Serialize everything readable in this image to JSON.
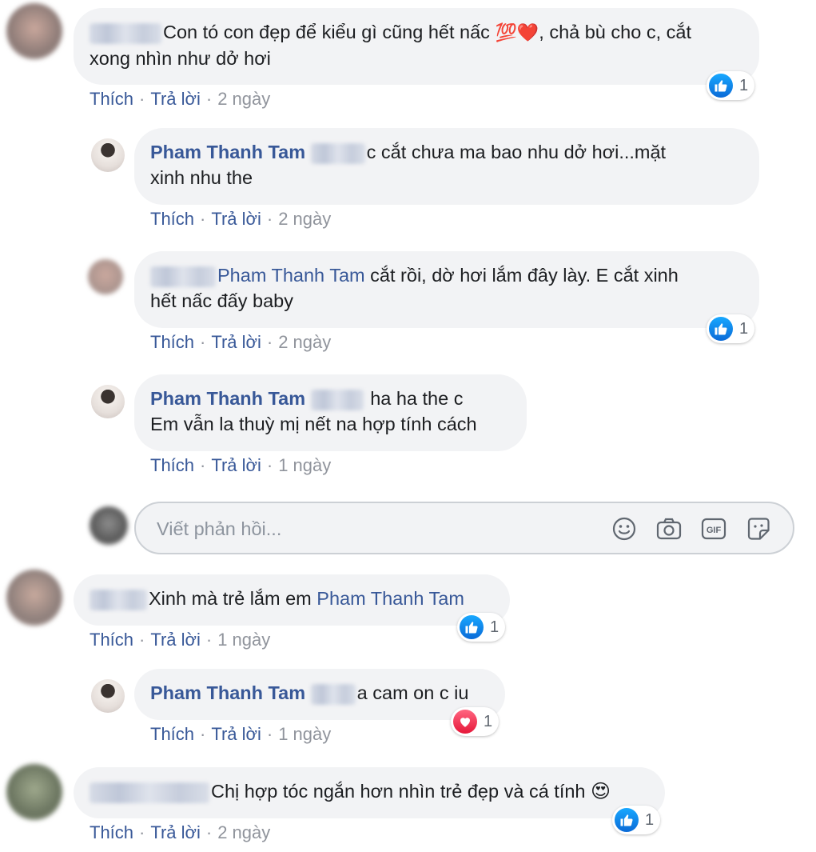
{
  "comments": [
    {
      "text": "Con tó con đẹp để kiểu gì cũng hết nấc",
      "emoji": "💯❤️",
      "text_after": ", chả bù cho c, cắt",
      "text_line2": "xong nhìn như dở hơi",
      "actions": {
        "like": "Thích",
        "reply": "Trả lời",
        "time": "2 ngày"
      },
      "reaction": {
        "type": "like",
        "count": "1"
      }
    },
    {
      "author": "Pham Thanh Tam",
      "text": "c cắt chưa ma bao nhu dở hơi...mặt",
      "text_line2": "xinh nhu the",
      "actions": {
        "like": "Thích",
        "reply": "Trả lời",
        "time": "2 ngày"
      }
    },
    {
      "mention": "Pham Thanh Tam",
      "text": " cắt rồi, dờ hơi lắm đây lày. E cắt xinh",
      "text_line2": "hết nấc đấy baby",
      "actions": {
        "like": "Thích",
        "reply": "Trả lời",
        "time": "2 ngày"
      },
      "reaction": {
        "type": "like",
        "count": "1"
      }
    },
    {
      "author": "Pham Thanh Tam",
      "text": "ha ha the c",
      "text_line2": "Em vẫn la thuỳ mị nết na hợp tính cách",
      "actions": {
        "like": "Thích",
        "reply": "Trả lời",
        "time": "1 ngày"
      }
    },
    {
      "text": "Xinh mà trẻ lắm em ",
      "mention": "Pham Thanh Tam",
      "actions": {
        "like": "Thích",
        "reply": "Trả lời",
        "time": "1 ngày"
      },
      "reaction": {
        "type": "like",
        "count": "1"
      }
    },
    {
      "author": "Pham Thanh Tam",
      "text": "a cam on c iu",
      "actions": {
        "like": "Thích",
        "reply": "Trả lời",
        "time": "1 ngày"
      },
      "reaction": {
        "type": "love",
        "count": "1"
      }
    },
    {
      "text": "Chị hợp tóc ngắn hơn nhìn trẻ đẹp và cá tính",
      "emoji": "😍",
      "actions": {
        "like": "Thích",
        "reply": "Trả lời",
        "time": "2 ngày"
      },
      "reaction": {
        "type": "like",
        "count": "1"
      }
    }
  ],
  "reply_box": {
    "placeholder": "Viết phản hồi...",
    "tools": [
      "smiley-icon",
      "camera-icon",
      "gif-icon",
      "sticker-icon"
    ],
    "gif_label": "GIF"
  },
  "colors": {
    "link": "#385898",
    "bubble": "#f2f3f5",
    "meta": "#90949c",
    "like": "#0a6ad7",
    "love": "#e61739"
  }
}
